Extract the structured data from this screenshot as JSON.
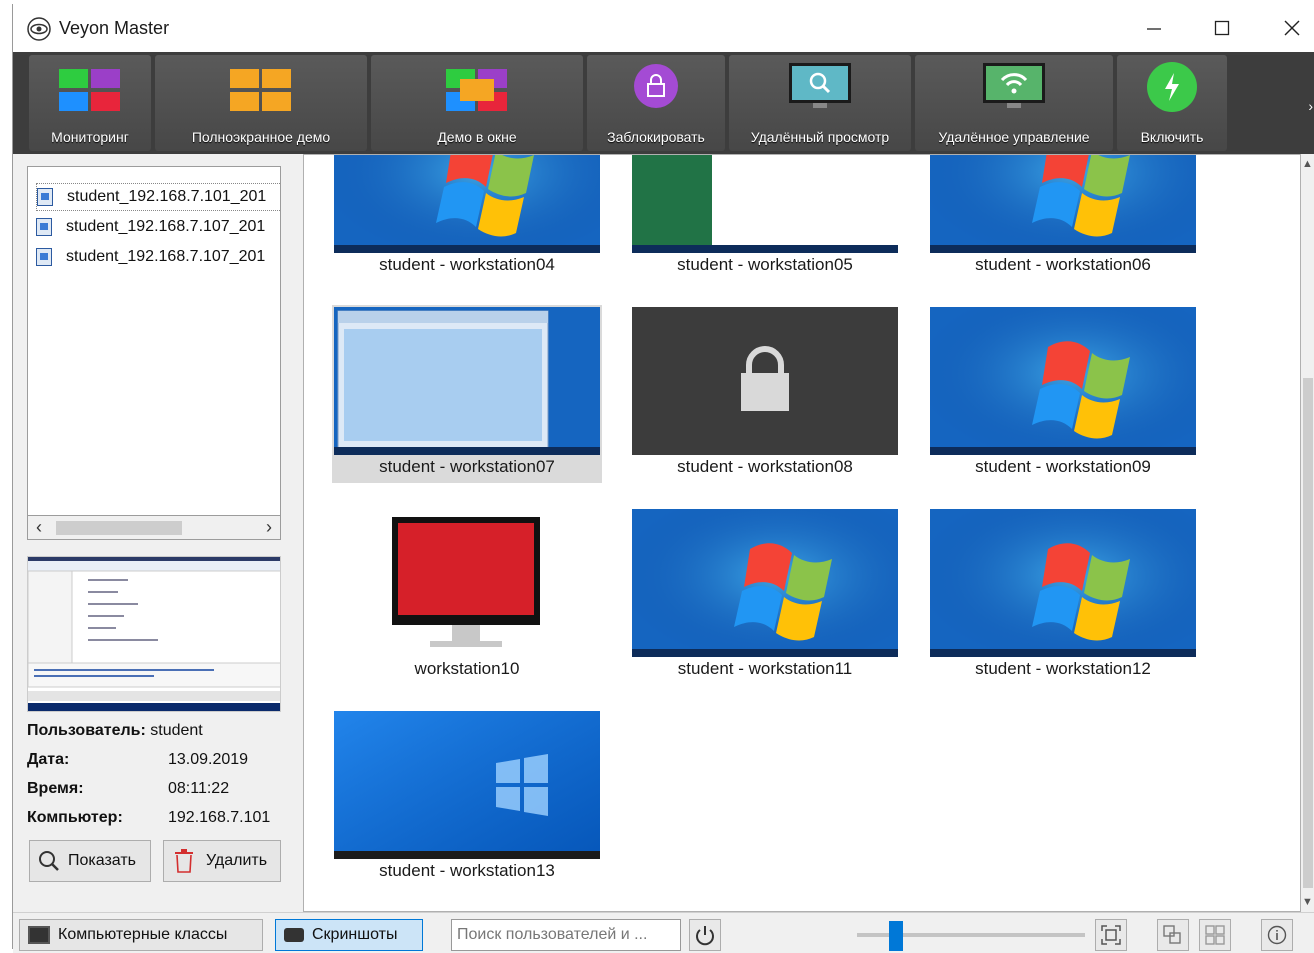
{
  "window": {
    "title": "Veyon Master"
  },
  "toolbar": {
    "buttons": [
      {
        "label": "Мониторинг"
      },
      {
        "label": "Полноэкранное демо"
      },
      {
        "label": "Демо в окне"
      },
      {
        "label": "Заблокировать"
      },
      {
        "label": "Удалённый просмотр"
      },
      {
        "label": "Удалённое управление"
      },
      {
        "label": "Включить"
      }
    ],
    "more": "›"
  },
  "screenshots": {
    "files": [
      "student_192.168.7.101_201",
      "student_192.168.7.107_201",
      "student_192.168.7.107_201"
    ]
  },
  "details": {
    "user_label": "Пользователь:",
    "user": "student",
    "date_label": "Дата:",
    "date": "13.09.2019",
    "time_label": "Время:",
    "time": "08:11:22",
    "computer_label": "Компьютер:",
    "computer": "192.168.7.101"
  },
  "actions": {
    "show": "Показать",
    "delete": "Удалить"
  },
  "computers": [
    {
      "label": "student - workstation04",
      "screen": "win7"
    },
    {
      "label": "student - workstation05",
      "screen": "app"
    },
    {
      "label": "student - workstation06",
      "screen": "win7"
    },
    {
      "label": "student - workstation07",
      "screen": "window"
    },
    {
      "label": "student - workstation08",
      "screen": "locked"
    },
    {
      "label": "student - workstation09",
      "screen": "win7"
    },
    {
      "label": "workstation10",
      "screen": "offline"
    },
    {
      "label": "student - workstation11",
      "screen": "win7"
    },
    {
      "label": "student - workstation12",
      "screen": "win7"
    },
    {
      "label": "student - workstation13",
      "screen": "win10"
    }
  ],
  "statusbar": {
    "classes": "Компьютерные классы",
    "screenshots": "Скриншоты",
    "search_placeholder": "Поиск пользователей и ...",
    "zoom_fraction": 0.15
  },
  "colors": {
    "accent": "#0078d7",
    "toolbar": "#3d3d3d",
    "offline_monitor": "#d62029"
  }
}
